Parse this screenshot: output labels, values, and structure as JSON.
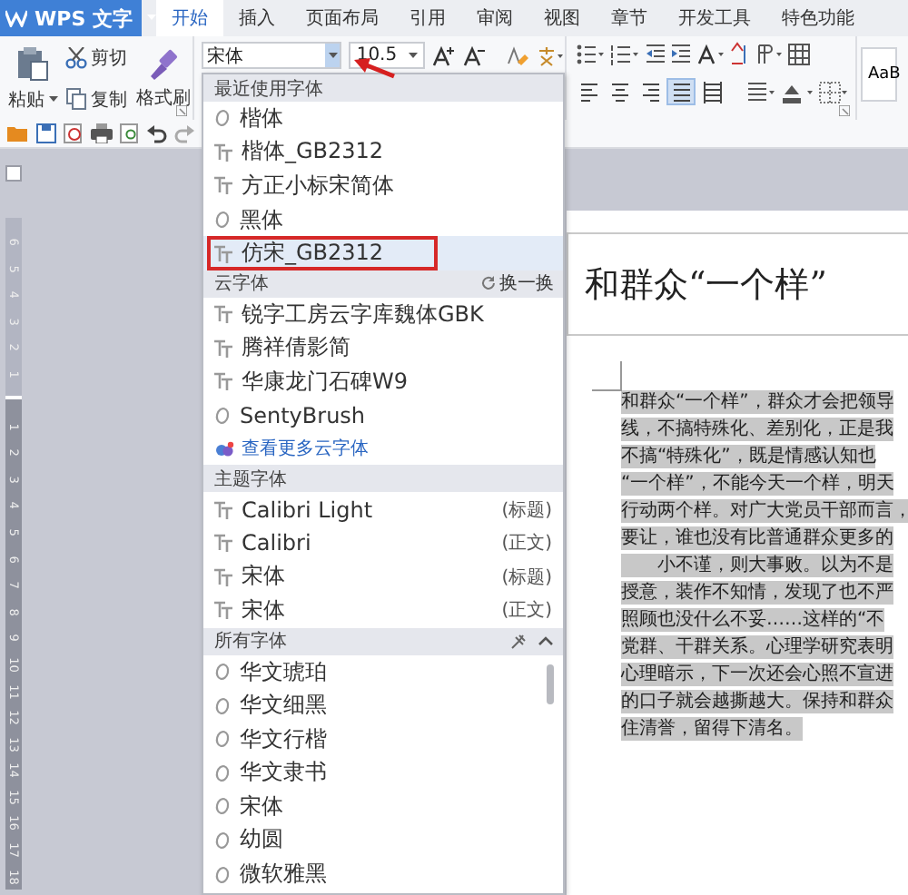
{
  "app": {
    "title": "WPS 文字"
  },
  "tabs": [
    {
      "label": "开始",
      "selected": true
    },
    {
      "label": "插入",
      "selected": false
    },
    {
      "label": "页面布局",
      "selected": false
    },
    {
      "label": "引用",
      "selected": false
    },
    {
      "label": "审阅",
      "selected": false
    },
    {
      "label": "视图",
      "selected": false
    },
    {
      "label": "章节",
      "selected": false
    },
    {
      "label": "开发工具",
      "selected": false
    },
    {
      "label": "特色功能",
      "selected": false
    }
  ],
  "clipboard": {
    "paste": "粘贴",
    "cut": "剪切",
    "copy": "复制",
    "format_painter": "格式刷"
  },
  "font": {
    "name": "宋体",
    "size": "10.5"
  },
  "alignments": [
    {
      "kind": "left",
      "selected": false
    },
    {
      "kind": "center",
      "selected": false
    },
    {
      "kind": "right",
      "selected": false
    },
    {
      "kind": "justify",
      "selected": true
    },
    {
      "kind": "distributed",
      "selected": false
    }
  ],
  "style_gallery": {
    "sample": "AaB"
  },
  "ruler": {
    "upper": [
      "6",
      "5",
      "4",
      "3",
      "2",
      "1"
    ],
    "lower": [
      "1",
      "2",
      "3",
      "4",
      "5",
      "6",
      "7",
      "8",
      "9",
      "10",
      "11",
      "12",
      "13",
      "14",
      "15",
      "16",
      "17",
      "18"
    ]
  },
  "font_menu": {
    "sections": [
      {
        "title": "最近使用字体",
        "items": [
          {
            "name": "楷体",
            "kind": "opentype",
            "selected": false,
            "outlined": false
          },
          {
            "name": "楷体_GB2312",
            "kind": "truetype",
            "selected": false,
            "outlined": false
          },
          {
            "name": "方正小标宋简体",
            "kind": "truetype",
            "selected": false,
            "outlined": false
          },
          {
            "name": "黑体",
            "kind": "opentype",
            "selected": false,
            "outlined": false
          },
          {
            "name": "仿宋_GB2312",
            "kind": "truetype",
            "selected": true,
            "outlined": true
          }
        ]
      },
      {
        "title": "云字体",
        "action": "换一换",
        "items": [
          {
            "name": "锐字工房云字库魏体GBK",
            "kind": "truetype",
            "selected": false,
            "outlined": false
          },
          {
            "name": "腾祥倩影简",
            "kind": "truetype",
            "selected": false,
            "outlined": false
          },
          {
            "name": "华康龙门石碑W9",
            "kind": "truetype",
            "selected": false,
            "outlined": false
          },
          {
            "name": "SentyBrush",
            "kind": "opentype",
            "selected": false,
            "outlined": false
          }
        ],
        "more_link": "查看更多云字体"
      },
      {
        "title": "主题字体",
        "items": [
          {
            "name": "Calibri Light",
            "kind": "truetype",
            "role": "(标题)",
            "selected": false,
            "outlined": false
          },
          {
            "name": "Calibri",
            "kind": "truetype",
            "role": "(正文)",
            "selected": false,
            "outlined": false
          },
          {
            "name": "宋体",
            "kind": "truetype",
            "role": "(标题)",
            "selected": false,
            "outlined": false
          },
          {
            "name": "宋体",
            "kind": "truetype",
            "role": "(正文)",
            "selected": false,
            "outlined": false
          }
        ]
      },
      {
        "title": "所有字体",
        "scrollable": true,
        "items": [
          {
            "name": "华文琥珀",
            "kind": "opentype",
            "selected": false,
            "outlined": false
          },
          {
            "name": "华文细黑",
            "kind": "opentype",
            "selected": false,
            "outlined": false
          },
          {
            "name": "华文行楷",
            "kind": "opentype",
            "selected": false,
            "outlined": false
          },
          {
            "name": "华文隶书",
            "kind": "opentype",
            "selected": false,
            "outlined": false
          },
          {
            "name": "宋体",
            "kind": "opentype",
            "selected": false,
            "outlined": false
          },
          {
            "name": "幼圆",
            "kind": "opentype",
            "selected": false,
            "outlined": false
          },
          {
            "name": "微软雅黑",
            "kind": "opentype",
            "selected": false,
            "outlined": false
          }
        ]
      }
    ]
  },
  "document": {
    "heading": "和群众“一个样”",
    "selected": true,
    "lines": [
      {
        "text": "和群众“一个样”，群众才会把领导",
        "indent": false
      },
      {
        "text": "线，不搞特殊化、差别化，正是我",
        "indent": false
      },
      {
        "text": "不搞“特殊化”，既是情感认知也",
        "indent": false
      },
      {
        "text": "“一个样”，不能今天一个样，明天",
        "indent": false
      },
      {
        "text": "行动两个样。对广大党员干部而言，",
        "indent": false
      },
      {
        "text": "要让，谁也没有比普通群众更多的",
        "indent": false
      },
      {
        "text": "　　小不谨，则大事败。以为不是",
        "indent": false
      },
      {
        "text": "授意，装作不知情，发现了也不严",
        "indent": false
      },
      {
        "text": "照顾也没什么不妥……这样的“不",
        "indent": false
      },
      {
        "text": "党群、干群关系。心理学研究表明",
        "indent": false
      },
      {
        "text": "心理暗示，下一次还会心照不宣进",
        "indent": false
      },
      {
        "text": "的口子就会越撕越大。保持和群众",
        "indent": false
      },
      {
        "text": "住清誉，留得下清名。",
        "indent": false
      }
    ]
  }
}
